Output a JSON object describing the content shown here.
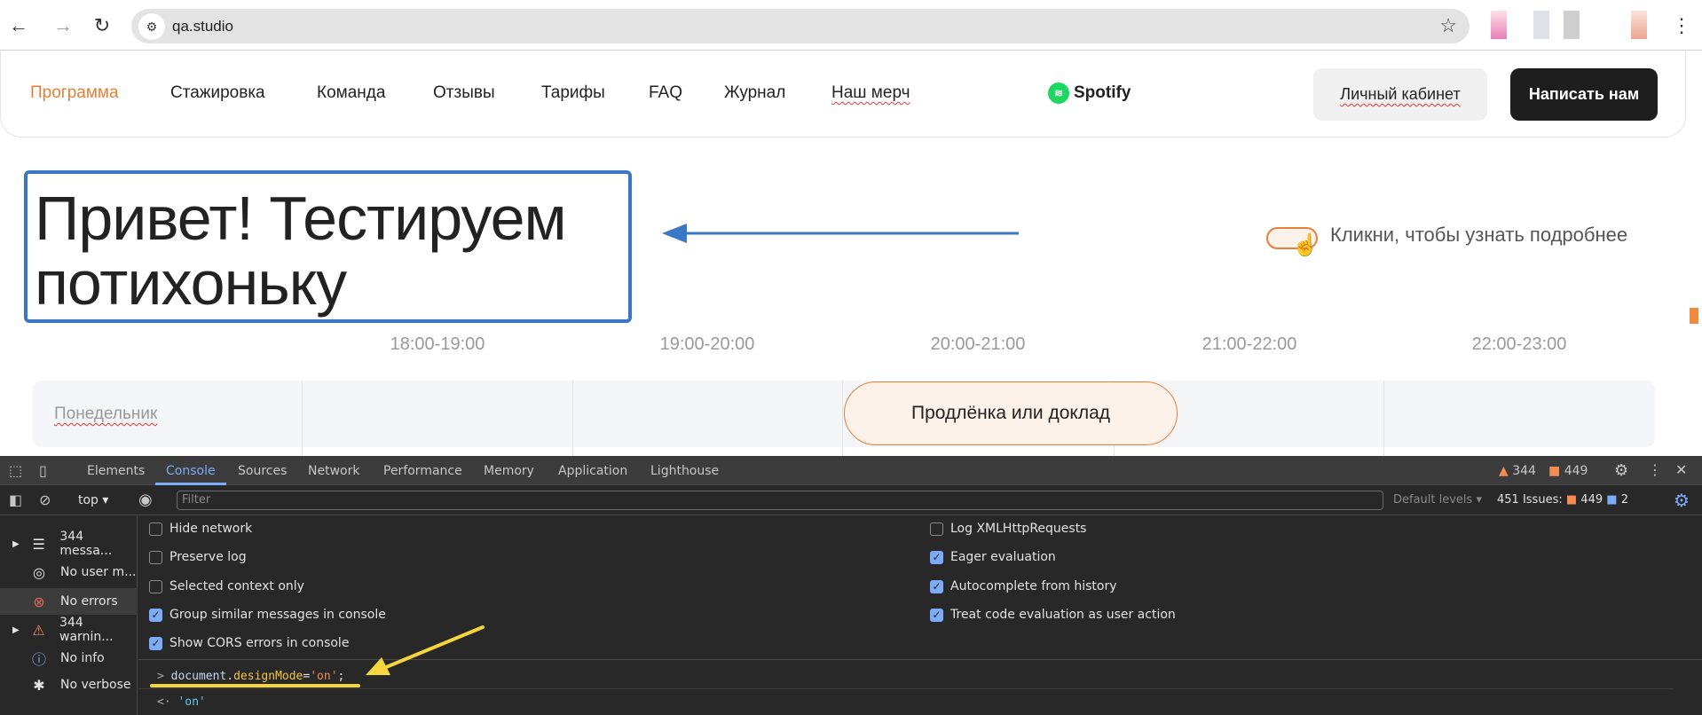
{
  "browser": {
    "url": "qa.studio"
  },
  "nav": {
    "items": [
      "Программа",
      "Стажировка",
      "Команда",
      "Отзывы",
      "Тарифы",
      "FAQ",
      "Журнал",
      "Наш мерч"
    ],
    "logo": "Spotify",
    "cabinet": "Личный кабинет",
    "write": "Написать нам"
  },
  "hero": {
    "title": "Привет! Тестируем потихоньку",
    "hint": "Кликни, чтобы узнать подробнее"
  },
  "schedule": {
    "times": [
      "18:00-19:00",
      "19:00-20:00",
      "20:00-21:00",
      "21:00-22:00",
      "22:00-23:00"
    ],
    "day": "Понедельник",
    "event": "Продлёнка или доклад"
  },
  "devtools": {
    "tabs": [
      "Elements",
      "Console",
      "Sources",
      "Network",
      "Performance",
      "Memory",
      "Application",
      "Lighthouse"
    ],
    "warnings": "344",
    "issues_count": "449",
    "context": "top",
    "filter_placeholder": "Filter",
    "levels": "Default levels",
    "issues_label": "451 Issues:",
    "issues_errors": "449",
    "issues_info": "2",
    "sidebar": [
      "344 messa...",
      "No user m...",
      "No errors",
      "344 warnin...",
      "No info",
      "No verbose"
    ],
    "settings_left": [
      {
        "label": "Hide network",
        "checked": false
      },
      {
        "label": "Preserve log",
        "checked": false
      },
      {
        "label": "Selected context only",
        "checked": false
      },
      {
        "label": "Group similar messages in console",
        "checked": true
      },
      {
        "label": "Show CORS errors in console",
        "checked": true
      }
    ],
    "settings_right": [
      {
        "label": "Log XMLHttpRequests",
        "checked": false
      },
      {
        "label": "Eager evaluation",
        "checked": true
      },
      {
        "label": "Autocomplete from history",
        "checked": true
      },
      {
        "label": "Treat code evaluation as user action",
        "checked": true
      }
    ],
    "input": {
      "obj": "document",
      "dot": ".",
      "prop": "designMode",
      "eq": "=",
      "str": "'on'",
      "semi": ";"
    },
    "output": "'on'"
  },
  "colors": {
    "accent": "#e8803a",
    "highlight_box": "#3a77c4",
    "annotation": "#f5d63d"
  }
}
